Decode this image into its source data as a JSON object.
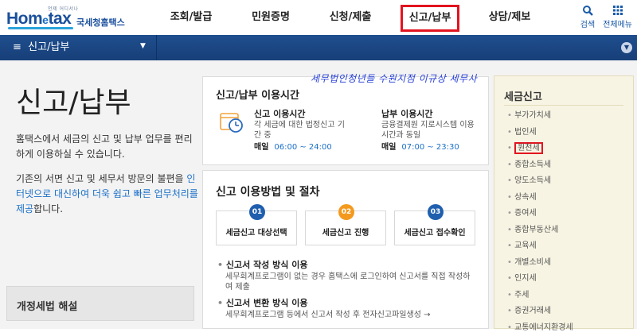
{
  "header": {
    "logo": {
      "tagline": "언제 어디서나",
      "wordmark_a": "Hom",
      "wordmark_b": "e",
      "wordmark_c": "tax",
      "service_name": "국세청홈택스"
    },
    "menu": [
      {
        "label": "조회/발급",
        "active": false
      },
      {
        "label": "민원증명",
        "active": false
      },
      {
        "label": "신청/제출",
        "active": false
      },
      {
        "label": "신고/납부",
        "active": true
      },
      {
        "label": "상담/제보",
        "active": false
      }
    ],
    "tools": {
      "search_label": "검색",
      "all_menu_label": "전체메뉴"
    }
  },
  "subnav": {
    "label": "신고/납부"
  },
  "hero": {
    "title": "신고/납부",
    "desc1": "홈택스에서 세금의 신고 및 납부 업무를 편리하게 이용하실 수 있습니다.",
    "desc2_a": "기존의 서면 신고 및 세무서 방문의 불편을 ",
    "desc2_b": "인터넷으로 대신하여 더욱 쉽고 빠른 업무처리를 제공",
    "desc2_c": "합니다.",
    "left_box": "개정세법 해설"
  },
  "hours_card": {
    "title": "신고/납부 이용시간",
    "report": {
      "title": "신고 이용시간",
      "desc": "각 세금에 대한 법정신고 기간 중",
      "time_label": "매일",
      "time_value": "06:00 ~ 24:00"
    },
    "payment": {
      "title": "납부 이용시간",
      "desc": "금융결제원 지로시스템 이용시간과 동일",
      "time_label": "매일",
      "time_value": "07:00 ~ 23:30"
    }
  },
  "procedure_card": {
    "title": "신고 이용방법 및 절차",
    "steps": [
      {
        "num": "01",
        "label": "세금신고 대상선택",
        "color": "#1f5fae"
      },
      {
        "num": "02",
        "label": "세금신고 진행",
        "color": "#f39a1e"
      },
      {
        "num": "03",
        "label": "세금신고 접수확인",
        "color": "#1f5fae"
      }
    ],
    "methods": [
      {
        "title": "신고서 작성 방식 이용",
        "desc": "세무회계프로그램이 없는 경우 홈택스에 로그인하여 신고서를 직접 작성하여 제출"
      },
      {
        "title": "신고서 변환 방식 이용",
        "desc": "세무회계프로그램 등에서 신고서 작성 후 전자신고파일생성 →"
      }
    ]
  },
  "tax_panel": {
    "title": "세금신고",
    "items": [
      "부가가치세",
      "법인세",
      "원천세",
      "종합소득세",
      "양도소득세",
      "상속세",
      "증여세",
      "종합부동산세",
      "교육세",
      "개별소비세",
      "인지세",
      "주세",
      "증권거래세",
      "교통에너지환경세"
    ],
    "highlighted": "원천세"
  },
  "handwriting": "세무법인청년들 수원지점 이규상 세무사",
  "colors": {
    "brand_blue": "#1a4f9c",
    "nav_bar": "#1f4e8e",
    "highlight_red": "#e2141f",
    "panel_bg": "#f7f4e3",
    "link_blue": "#1a6fc8"
  }
}
